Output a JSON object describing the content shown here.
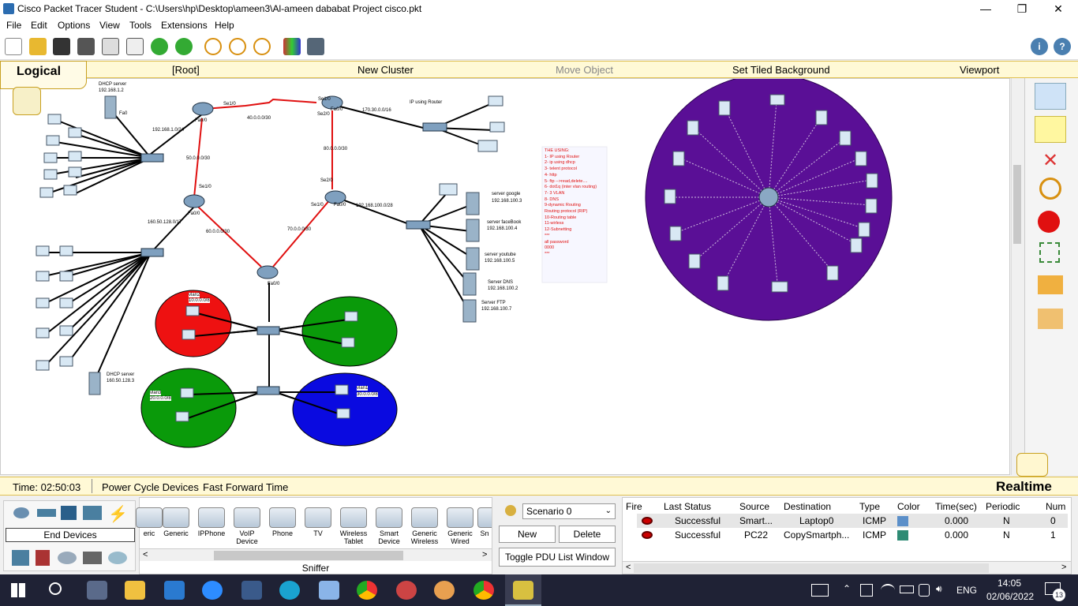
{
  "window": {
    "title": "Cisco Packet Tracer Student - C:\\Users\\hp\\Desktop\\ameen3\\Al-ameen dababat Project cisco.pkt",
    "minimize": "—",
    "restore": "❐",
    "close": "✕"
  },
  "menu": [
    "File",
    "Edit",
    "Options",
    "View",
    "Tools",
    "Extensions",
    "Help"
  ],
  "toolbar": {
    "icons": [
      "new-icon",
      "open-icon",
      "save-icon",
      "print-icon",
      "activity-wizard-icon",
      "copy-icon",
      "paste-icon",
      "undo-icon",
      "redo-icon",
      "zoom-in-icon",
      "zoom-reset-icon",
      "zoom-out-icon",
      "palette-icon",
      "custom-device-icon"
    ],
    "info": "i",
    "help": "?"
  },
  "logicalbar": {
    "tab": "Logical",
    "root": "[Root]",
    "new_cluster": "New Cluster",
    "move_object": "Move Object",
    "tiled_bg": "Set Tiled Background",
    "viewport": "Viewport"
  },
  "topology": {
    "dhcp1": "DHCP server",
    "dhcp1_ip": "192.168.1.2",
    "dhcp2": "DHCP server",
    "dhcp2_ip": "160.50.128.3",
    "net_192": "192.168.1.0/24",
    "net_40": "40.0.0.0/30",
    "net_50": "50.0.0.0/30",
    "net_80": "80.0.0.0/30",
    "net_170": "170.30.0.0/16",
    "net_160": "160.50.128.0/17",
    "net_60": "60.0.0.0/30",
    "net_70": "70.0.0.0/30",
    "net_192_100": "192.168.100.0/28",
    "ip_router": "IP using Router",
    "srv_google": "server google",
    "srv_google_ip": "192.168.100.3",
    "srv_facebook": "server faceBook",
    "srv_facebook_ip": "192.168.100.4",
    "srv_youtube": "server youtube",
    "srv_youtube_ip": "192.168.100.5",
    "srv_dns": "Server DNS",
    "srv_dns_ip": "192.168.100.2",
    "srv_ftp": "Server FTP",
    "srv_ftp_ip": "192.168.100.7",
    "vlan2": "vlan2",
    "vlan2_net": "10.0.0.0/8",
    "vlan3": "vlan3",
    "vlan3_net": "20.0.0.0/8",
    "vlan1": "vlan1",
    "vlan1_net": "30.0.0.0/8",
    "notes": [
      "THE USING:",
      "1- IP using Router",
      "2- ip using dhcp",
      "3- telent protocol",
      "4- http",
      "5- ftp -->read,delete....",
      "6- dot1q (inter vlan routing)",
      "7- 3 VLAN",
      "8- DNS",
      "9-dynamic Routing",
      "Routing protocol (RIP)",
      "10-Routing table",
      "11-wirless",
      "12-Subnetting",
      "***",
      "all password",
      "0000",
      "***"
    ],
    "port_fa0": "Fa0",
    "port_fa00": "Fa0/0",
    "port_se10": "Se1/0",
    "port_se20": "Se2/0"
  },
  "rightpanel": [
    "select-icon",
    "note-icon",
    "delete-icon",
    "inspect-icon",
    "draw-shape-icon",
    "resize-icon",
    "add-simple-pdu-icon",
    "add-complex-pdu-icon"
  ],
  "status": {
    "time": "Time: 02:50:03",
    "power_cycle": "Power Cycle Devices",
    "fast_forward": "Fast Forward Time",
    "realtime": "Realtime"
  },
  "devices": {
    "category_label": "End Devices",
    "sniffer": "Sniffer",
    "items": [
      "eric",
      "Generic",
      "IPPhone",
      "VoIP Device",
      "Phone",
      "TV",
      "Wireless Tablet",
      "Smart Device",
      "Generic Wireless",
      "Generic Wired",
      "Sn"
    ]
  },
  "scenario": {
    "select": "Scenario 0",
    "new": "New",
    "delete": "Delete",
    "toggle": "Toggle PDU List Window"
  },
  "pdu": {
    "headers": [
      "Fire",
      "Last Status",
      "Source",
      "Destination",
      "Type",
      "Color",
      "Time(sec)",
      "Periodic",
      "Num"
    ],
    "rows": [
      {
        "status": "Successful",
        "source": "Smart...",
        "destination": "Laptop0",
        "type": "ICMP",
        "color": "#5b8fc9",
        "time": "0.000",
        "periodic": "N",
        "num": "0"
      },
      {
        "status": "Successful",
        "source": "PC22",
        "destination": "CopySmartph...",
        "type": "ICMP",
        "color": "#2e8b74",
        "time": "0.000",
        "periodic": "N",
        "num": "1"
      }
    ]
  },
  "taskbar": {
    "lang": "ENG",
    "time": "14:05",
    "date": "02/06/2022",
    "notif": "13"
  }
}
